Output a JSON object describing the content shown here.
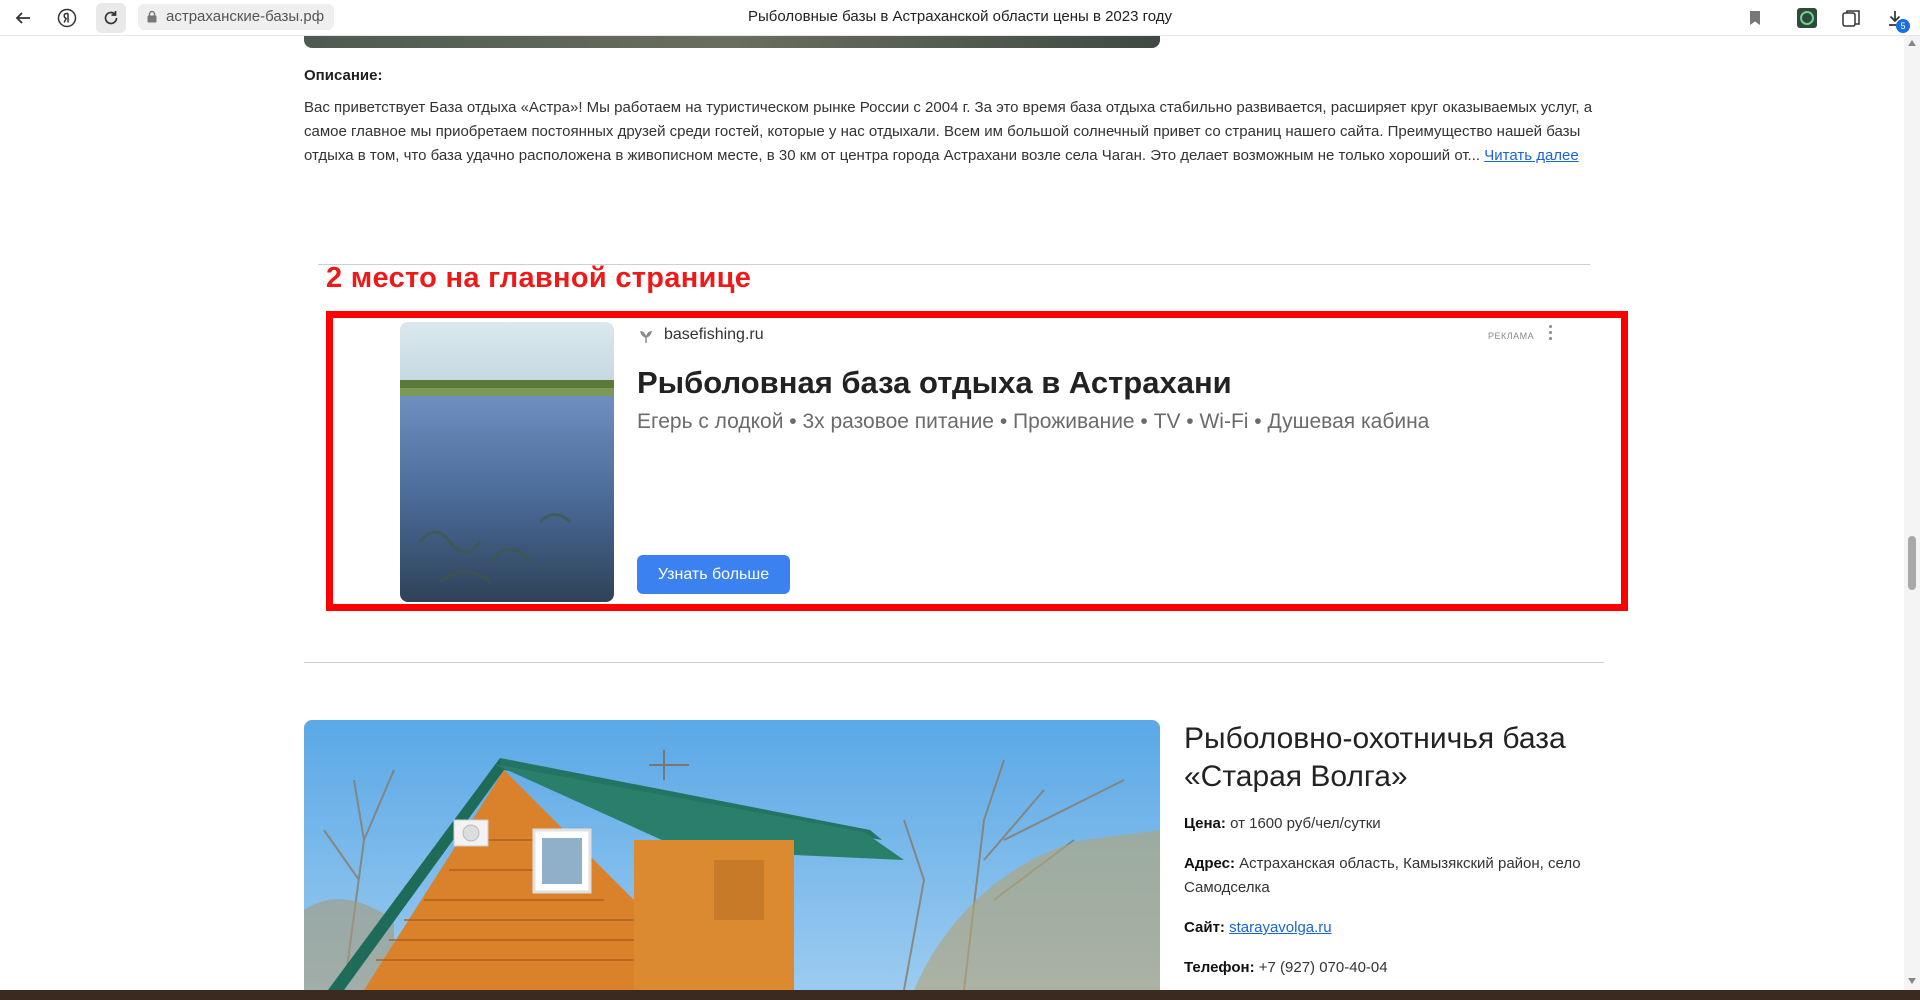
{
  "browser": {
    "address": "астраханские-базы.рф",
    "tab_title": "Рыболовные базы в Астраханской области цены в 2023 году",
    "download_count": "5"
  },
  "description": {
    "label": "Описание:",
    "text": "Вас приветствует База отдыха «Астра»! Мы работаем на туристическом рынке России с 2004 г. За это время база отдыха стабильно развивается, расширяет круг оказываемых услуг, а самое главное мы приобретаем постоянных друзей среди гостей, которые у нас отдыхали. Всем им большой солнечный привет со страниц нашего сайта. Преимущество нашей базы отдыха в том, что база удачно расположена в живописном месте, в 30 км от центра города Астрахани возле села Чаган. Это делает возможным не только хороший от...",
    "read_more": "Читать далее"
  },
  "annotation": {
    "title": "2 место на главной странице",
    "color": "#ff0000"
  },
  "ad": {
    "domain": "basefishing.ru",
    "label": "РЕКЛАМА",
    "headline": "Рыболовная база отдыха в Астрахани",
    "subtitle": "Егерь с лодкой • 3х разовое питание • Проживание • TV • Wi-Fi • Душевая кабина",
    "cta": "Узнать больше"
  },
  "listing": {
    "title": "Рыболовно-охотничья база «Старая Волга»",
    "price_label": "Цена:",
    "price_value": "от 1600 руб/чел/сутки",
    "address_label": "Адрес:",
    "address_value": "Астраханская область, Камызякский район, село Самодселка",
    "site_label": "Сайт:",
    "site_value": "starayavolga.ru",
    "phone_label": "Телефон:",
    "phone_value": "+7 (927) 070-40-04"
  }
}
